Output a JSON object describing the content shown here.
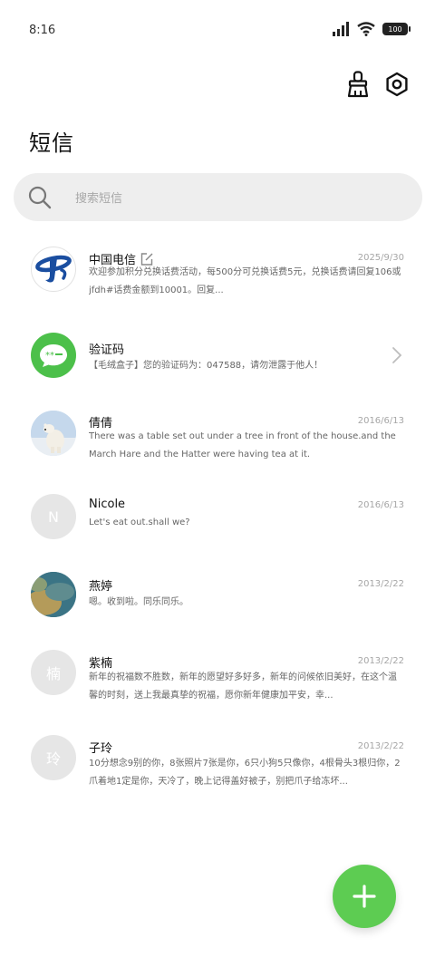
{
  "status_bar": {
    "time": "8:16",
    "battery": "100"
  },
  "page": {
    "title": "短信"
  },
  "search": {
    "placeholder": "搜索短信"
  },
  "messages": [
    {
      "name": "中国电信",
      "date": "2025/9/30",
      "preview": "欢迎参加积分兑换话费活动，每500分可兑换话费5元，兑换话费请回复106或jfdh#话费金额到10001。回复..."
    },
    {
      "name": "验证码",
      "date": "",
      "preview": "【毛绒盒子】您的验证码为：047588，请勿泄露于他人！"
    },
    {
      "name": "倩倩",
      "date": "2016/6/13",
      "preview": "There was a table set out under a tree in front of the house.and the March Hare and the Hatter were having tea at it."
    },
    {
      "name": "Nicole",
      "date": "2016/6/13",
      "preview": "Let's eat out.shall we?",
      "initial": "N"
    },
    {
      "name": "燕婷",
      "date": "2013/2/22",
      "preview": "嗯。收到啦。同乐同乐。"
    },
    {
      "name": "紫楠",
      "date": "2013/2/22",
      "preview": "新年的祝福数不胜数，新年的愿望好多好多，新年的问候依旧美好，在这个温馨的时刻，送上我最真挚的祝福，愿你新年健康加平安，幸...",
      "initial": "楠"
    },
    {
      "name": "子玲",
      "date": "2013/2/22",
      "preview": "10分想念9别的你，8张照片7张是你，6只小狗5只像你，4根骨头3根归你，2爪着地1定是你，天冷了，晚上记得盖好被子，别把爪子给冻坏...",
      "initial": "玲"
    }
  ],
  "colors": {
    "accent": "#5dcc52",
    "telecom_blue": "#1a4ea0",
    "verify_green": "#4cc04a"
  }
}
